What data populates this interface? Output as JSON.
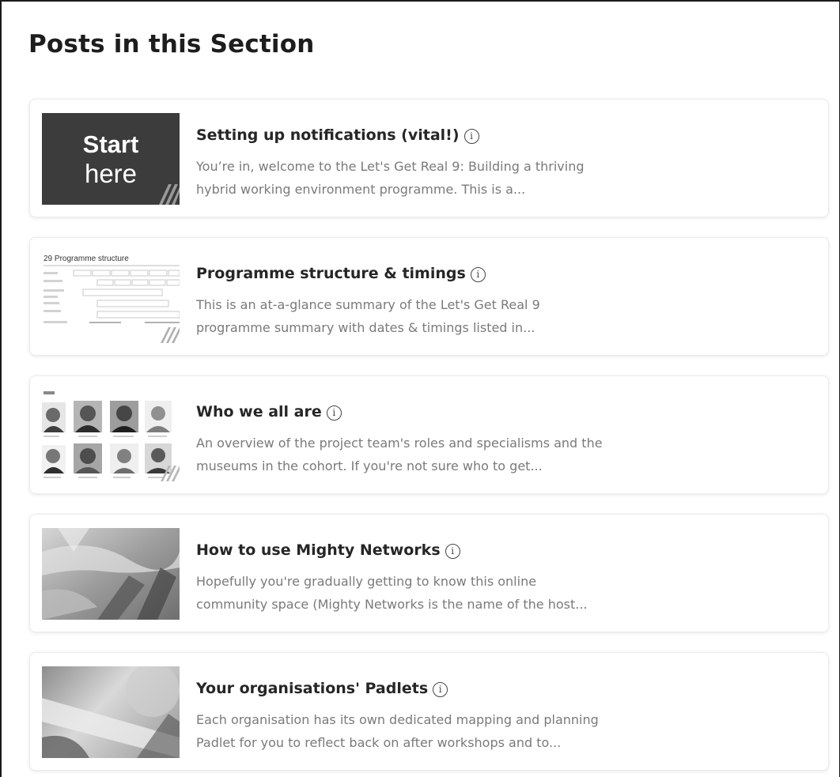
{
  "section": {
    "title": "Posts in this Section"
  },
  "posts": [
    {
      "title": "Setting up notifications (vital!)",
      "excerpt_line1": "You’re in, welcome to the Let's Get Real 9: Building a thriving",
      "excerpt_line2": "hybrid working environment programme. This is a...",
      "thumb_line1": "Start",
      "thumb_line2": "here"
    },
    {
      "title": "Programme structure & timings",
      "excerpt_line1": "This is an at-a-glance summary of the Let's Get Real 9",
      "excerpt_line2": "programme summary with dates & timings listed in...",
      "thumb_heading": "Programme structure"
    },
    {
      "title": "Who we all are",
      "excerpt_line1": "An overview of the project team's roles and specialisms and the",
      "excerpt_line2": "museums in the cohort. If you're not sure who to get..."
    },
    {
      "title": "How to use Mighty Networks",
      "excerpt_line1": "Hopefully you're gradually getting to know this online",
      "excerpt_line2": "community space (Mighty Networks is the name of the host..."
    },
    {
      "title": "Your organisations' Padlets",
      "excerpt_line1": "Each organisation has its own dedicated mapping and planning",
      "excerpt_line2": "Padlet for you to reflect back on after workshops and to..."
    }
  ],
  "icons": {
    "info": "info-icon"
  },
  "colors": {
    "start_thumb_bg": "#3c3c3c",
    "excerpt": "#7a7a7a"
  }
}
